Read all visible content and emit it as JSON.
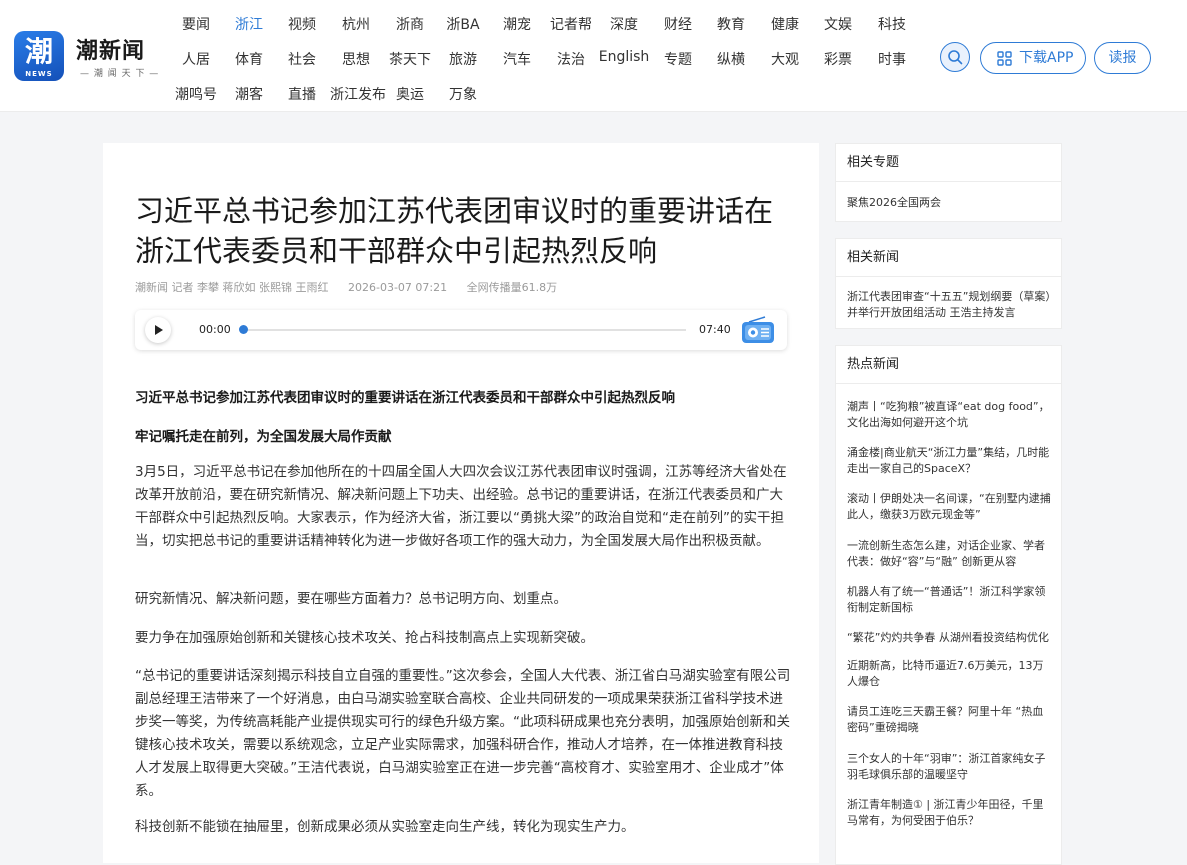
{
  "header": {
    "logo_char": "潮",
    "logo_badge": "NEWS",
    "site_name": "潮新闻",
    "tagline": "— 潮 闻 天 下 —",
    "nav_row1": [
      "要闻",
      "浙江",
      "视频",
      "杭州",
      "浙商",
      "浙BA",
      "潮宠",
      "记者帮",
      "深度",
      "财经",
      "教育",
      "健康",
      "文娱",
      "科技"
    ],
    "nav_row2": [
      "人居",
      "体育",
      "社会",
      "思想",
      "茶天下",
      "旅游",
      "汽车",
      "法治",
      "English",
      "专题",
      "纵横",
      "大观",
      "彩票",
      "时事"
    ],
    "nav_row3": [
      "潮鸣号",
      "潮客",
      "直播",
      "浙江发布",
      "奥运",
      "万象"
    ],
    "active_nav": "浙江",
    "download_label": "下载APP",
    "read_label": "读报",
    "accent_color": "#2e7bd6"
  },
  "article": {
    "title": "习近平总书记参加江苏代表团审议时的重要讲话在浙江代表委员和干部群众中引起热烈反响",
    "source": "潮新闻 记者 李攀 蒋欣如 张熙锦 王雨红",
    "datetime": "2026-03-07 07:21",
    "views": "全网传播量61.8万",
    "audio": {
      "current": "00:00",
      "total": "07:40"
    },
    "lead": "习近平总书记参加江苏代表团审议时的重要讲话在浙江代表委员和干部群众中引起热烈反响",
    "subheading": "牢记嘱托走在前列，为全国发展大局作贡献",
    "paragraphs": [
      "3月5日，习近平总书记在参加他所在的十四届全国人大四次会议江苏代表团审议时强调，江苏等经济大省处在改革开放前沿，要在研究新情况、解决新问题上下功夫、出经验。总书记的重要讲话，在浙江代表委员和广大干部群众中引起热烈反响。大家表示，作为经济大省，浙江要以“勇挑大梁”的政治自觉和“走在前列”的实干担当，切实把总书记的重要讲话精神转化为进一步做好各项工作的强大动力，为全国发展大局作出积极贡献。",
      "研究新情况、解决新问题，要在哪些方面着力？总书记明方向、划重点。",
      "要力争在加强原始创新和关键核心技术攻关、抢占科技制高点上实现新突破。",
      "“总书记的重要讲话深刻揭示科技自立自强的重要性。”这次参会，全国人大代表、浙江省白马湖实验室有限公司副总经理王洁带来了一个好消息，由白马湖实验室联合高校、企业共同研发的一项成果荣获浙江省科学技术进步奖一等奖，为传统高耗能产业提供现实可行的绿色升级方案。“此项科研成果也充分表明，加强原始创新和关键核心技术攻关，需要以系统观念，立足产业实际需求，加强科研合作，推动人才培养，在一体推进教育科技人才发展上取得更大突破。”王洁代表说，白马湖实验室正在进一步完善“高校育才、实验室用才、企业成才”体系。",
      "科技创新不能锁在抽屉里，创新成果必须从实验室走向生产线，转化为现实生产力。"
    ]
  },
  "sidebar": {
    "topics": {
      "title": "相关专题",
      "items": [
        "聚焦2026全国两会"
      ]
    },
    "related": {
      "title": "相关新闻",
      "items": [
        "浙江代表团审查“十五五”规划纲要（草案）并举行开放团组活动 王浩主持发言"
      ]
    },
    "hot": {
      "title": "热点新闻",
      "items": [
        "潮声丨“吃狗粮”被直译“eat dog food”，文化出海如何避开这个坑",
        "涌金楼|商业航天“浙江力量”集结，几时能走出一家自己的SpaceX？",
        "滚动丨伊朗处决一名间谍，“在别墅内逮捕此人，缴获3万欧元现金等”",
        "一流创新生态怎么建，对话企业家、学者代表：做好“容”与“融” 创新更从容",
        "机器人有了统一“普通话”！浙江科学家领衔制定新国标",
        "“繁花”灼灼共争春 从湖州看投资结构优化",
        "近期新高，比特币逼近7.6万美元，13万人爆仓",
        "请员工连吃三天霸王餐？阿里十年 “热血密码”重磅揭晓",
        "三个女人的十年“羽审”：浙江首家纯女子羽毛球俱乐部的温暖坚守",
        "浙江青年制造① | 浙江青少年田径，千里马常有，为何受困于伯乐？"
      ]
    }
  }
}
